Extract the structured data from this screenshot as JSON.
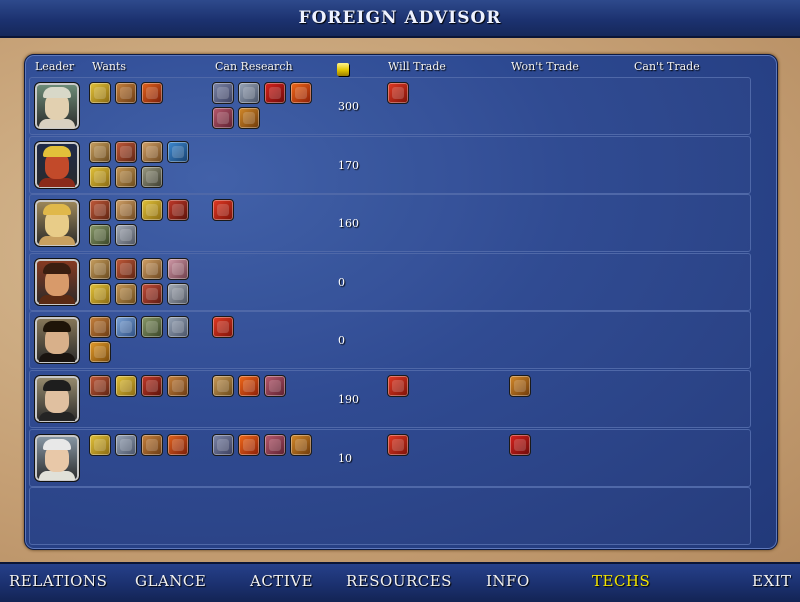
{
  "window": {
    "title": "FOREIGN ADVISOR"
  },
  "columns": {
    "leader": "Leader",
    "wants": "Wants",
    "can_research": "Can Research",
    "gold_icon": "gold-coins-icon",
    "will_trade": "Will Trade",
    "wont_trade": "Won't Trade",
    "cant_trade": "Can't Trade"
  },
  "colors": {
    "panel": "#2c4890",
    "parchment": "#c59f74",
    "menu_text": "#f2f2f2",
    "active_menu": "#f2e400"
  },
  "civs": [
    {
      "portrait": "roman-leader-portrait",
      "gold": "300",
      "wants": [
        "monarchy-tech-icon",
        "currency-tech-icon",
        "bronze-working-tech-icon"
      ],
      "can_research": [
        "feudalism-tech-icon",
        "mathematics-tech-icon",
        "communism-tech-icon",
        "gunpowder-tech-icon",
        "chivalry-tech-icon",
        "map-making-tech-icon"
      ],
      "will_trade": [
        "flag-tech-icon"
      ],
      "wont_trade": [],
      "cant_trade": []
    },
    {
      "portrait": "aztec-leader-portrait",
      "gold": "170",
      "wants": [
        "philosophy-tech-icon",
        "writing-tech-icon",
        "literacy-tech-icon",
        "seafaring-tech-icon",
        "monarchy-tech-icon",
        "iron-working-tech-icon",
        "astronomy-tech-icon"
      ],
      "can_research": [],
      "will_trade": [],
      "wont_trade": [],
      "cant_trade": []
    },
    {
      "portrait": "egyptian-leader-portrait",
      "gold": "160",
      "wants": [
        "writing-tech-icon",
        "literacy-tech-icon",
        "monarchy-tech-icon",
        "the-wheel-tech-icon",
        "construction-tech-icon",
        "compass-tech-icon"
      ],
      "can_research": [
        "flag-tech-icon"
      ],
      "will_trade": [],
      "wont_trade": [],
      "cant_trade": []
    },
    {
      "portrait": "spanish-leader-portrait",
      "gold": "0",
      "wants": [
        "philosophy-tech-icon",
        "writing-tech-icon",
        "literacy-tech-icon",
        "code-of-laws-tech-icon",
        "monarchy-tech-icon",
        "iron-working-tech-icon",
        "horseback-riding-tech-icon",
        "compass-tech-icon"
      ],
      "can_research": [],
      "will_trade": [],
      "wont_trade": [],
      "cant_trade": []
    },
    {
      "portrait": "american-leader-portrait",
      "gold": "0",
      "wants": [
        "currency-tech-icon",
        "mysticism-tech-icon",
        "construction-tech-icon",
        "mathematics-tech-icon",
        "pottery-tech-icon"
      ],
      "can_research": [
        "flag-tech-icon"
      ],
      "will_trade": [],
      "wont_trade": [],
      "cant_trade": []
    },
    {
      "portrait": "english-leader-portrait",
      "gold": "190",
      "wants": [
        "writing-tech-icon",
        "monarchy-tech-icon",
        "the-wheel-tech-icon",
        "currency-tech-icon"
      ],
      "can_research": [
        "iron-working-tech-icon",
        "gunpowder-tech-icon",
        "chivalry-tech-icon"
      ],
      "will_trade": [
        "flag-tech-icon"
      ],
      "wont_trade": [
        "map-making-tech-icon"
      ],
      "cant_trade": []
    },
    {
      "portrait": "indian-leader-portrait",
      "gold": "10",
      "wants": [
        "monarchy-tech-icon",
        "mathematics-tech-icon",
        "currency-tech-icon",
        "bronze-working-tech-icon"
      ],
      "can_research": [
        "feudalism-tech-icon",
        "gunpowder-tech-icon",
        "chivalry-tech-icon",
        "map-making-tech-icon"
      ],
      "will_trade": [
        "flag-tech-icon"
      ],
      "wont_trade": [
        "communism-tech-icon"
      ],
      "cant_trade": []
    }
  ],
  "menu": [
    {
      "label": "RELATIONS",
      "active": false
    },
    {
      "label": "GLANCE",
      "active": false
    },
    {
      "label": "ACTIVE",
      "active": false
    },
    {
      "label": "RESOURCES",
      "active": false
    },
    {
      "label": "INFO",
      "active": false
    },
    {
      "label": "TECHS",
      "active": true
    },
    {
      "label": "EXIT",
      "active": false
    }
  ]
}
